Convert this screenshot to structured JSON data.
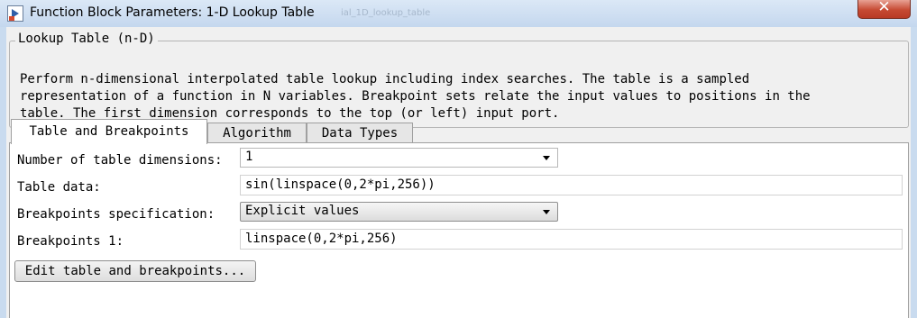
{
  "window": {
    "title": "Function Block Parameters: 1-D Lookup Table",
    "background_title": "ial_1D_lookup_table",
    "close_glyph": "✕"
  },
  "group": {
    "title": "Lookup Table (n-D)",
    "description": [
      "Perform n-dimensional interpolated table lookup including index searches. The table is a sampled",
      "representation of a function in N variables. Breakpoint sets relate the input values to positions in the",
      "table. The first dimension corresponds to the top (or left) input port."
    ]
  },
  "tabs": [
    {
      "label": "Table and Breakpoints",
      "active": true
    },
    {
      "label": "Algorithm",
      "active": false
    },
    {
      "label": "Data Types",
      "active": false
    }
  ],
  "params": {
    "num_dims_label": "Number of table dimensions:",
    "num_dims_value": "1",
    "table_data_label": "Table data:",
    "table_data_value": "sin(linspace(0,2*pi,256))",
    "bp_spec_label": "Breakpoints specification:",
    "bp_spec_value": "Explicit values",
    "bp1_label": "Breakpoints 1:",
    "bp1_value": "linspace(0,2*pi,256)",
    "edit_button": "Edit table and breakpoints..."
  }
}
